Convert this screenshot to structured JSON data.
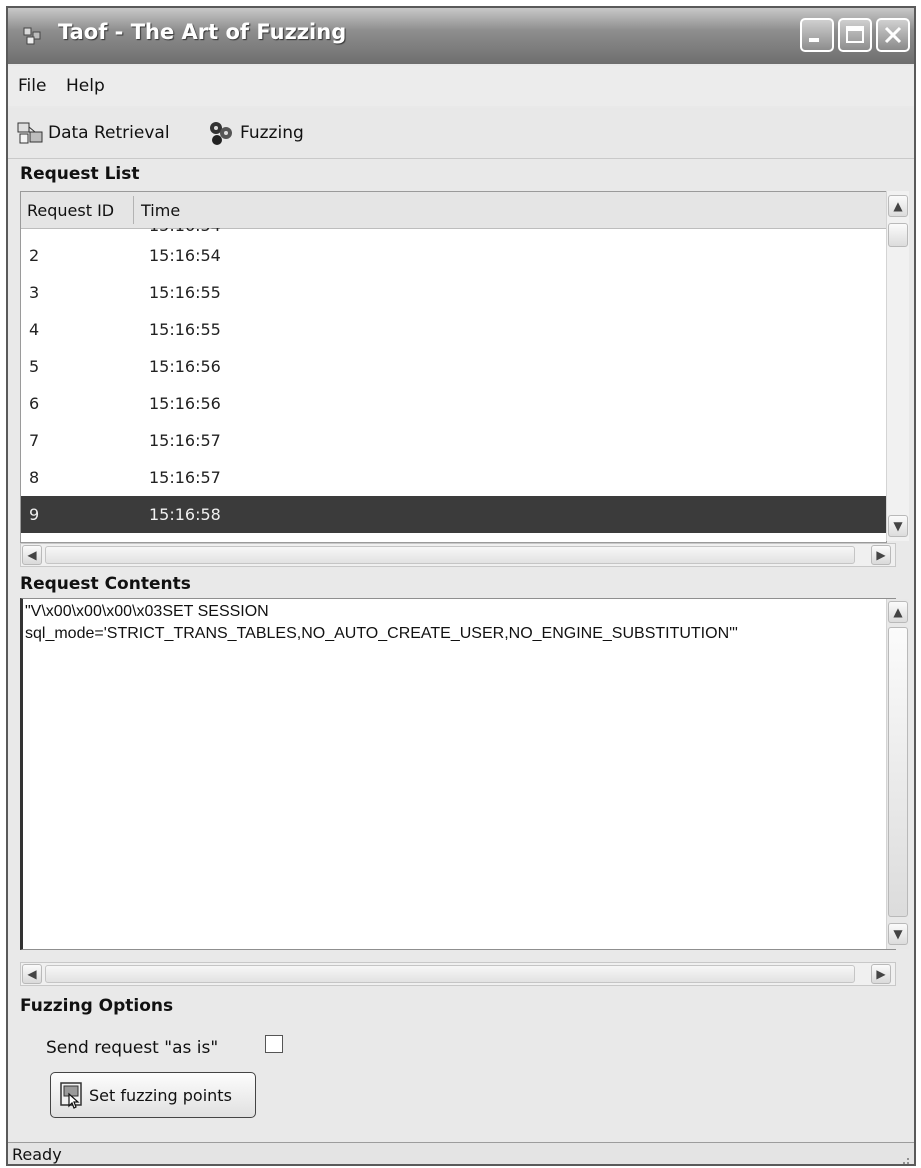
{
  "window": {
    "title": "Taof - The Art of Fuzzing"
  },
  "menu": {
    "file": "File",
    "help": "Help"
  },
  "toolbar": {
    "data_retrieval": "Data Retrieval",
    "fuzzing": "Fuzzing"
  },
  "request_list": {
    "label": "Request List",
    "columns": [
      "Request ID",
      "Time"
    ],
    "rows": [
      {
        "id": "2",
        "time": "15:16:54"
      },
      {
        "id": "3",
        "time": "15:16:55"
      },
      {
        "id": "4",
        "time": "15:16:55"
      },
      {
        "id": "5",
        "time": "15:16:56"
      },
      {
        "id": "6",
        "time": "15:16:56"
      },
      {
        "id": "7",
        "time": "15:16:57"
      },
      {
        "id": "8",
        "time": "15:16:57"
      },
      {
        "id": "9",
        "time": "15:16:58"
      }
    ],
    "selected_id": "9"
  },
  "request_contents": {
    "label": "Request Contents",
    "text": "\"V\\x00\\x00\\x00\\x03SET SESSION\nsql_mode='STRICT_TRANS_TABLES,NO_AUTO_CREATE_USER,NO_ENGINE_SUBSTITUTION'\""
  },
  "fuzzing_options": {
    "label": "Fuzzing Options",
    "send_as_is_label": "Send request \"as is\"",
    "send_as_is_checked": false,
    "set_points_button": "Set fuzzing points"
  },
  "status": {
    "text": "Ready"
  },
  "icons": {
    "app": "fuzz-app-icon",
    "data_retrieval": "data-retrieval-icon",
    "fuzzing": "fuzzing-icon",
    "set_points": "fuzzing-points-icon"
  }
}
